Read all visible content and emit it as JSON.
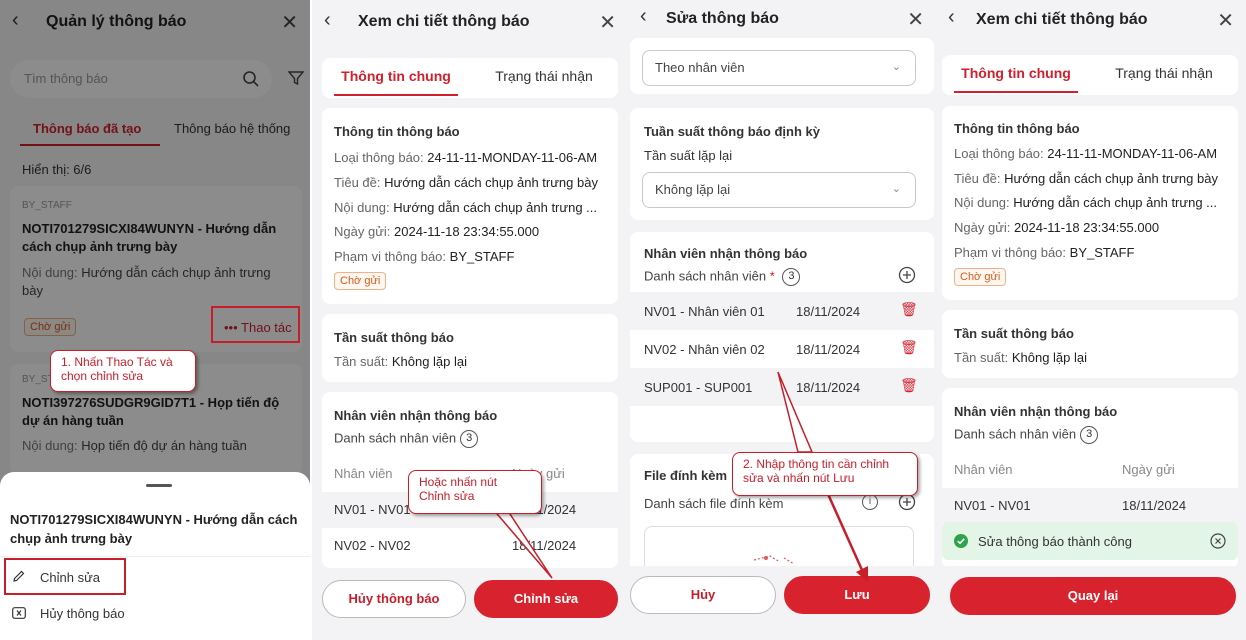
{
  "panel1": {
    "title": "Quản lý thông báo",
    "search_placeholder": "Tìm thông báo",
    "tabs": [
      "Thông báo đã tạo",
      "Thông báo hệ thống"
    ],
    "showing": "Hiển thị: 6/6",
    "card1": {
      "scope": "BY_STAFF",
      "title": "NOTI701279SICXI84WUNYN - Hướng dẫn cách chụp ảnh trưng bày",
      "content_label": "Nội dung:",
      "content": "Hướng dẫn cách chụp ảnh trưng bày",
      "status": "Chờ gửi",
      "action": "Thao tác"
    },
    "card2": {
      "scope": "BY_STAFF",
      "title": "NOTI397276SUDGR9GID7T1 - Họp tiến độ dự án hàng tuần",
      "content_label": "Nội dung:",
      "content": "Họp tiến độ dự án hàng tuần"
    },
    "sheet": {
      "title": "NOTI701279SICXI84WUNYN - Hướng dẫn cách chụp ảnh trưng bày",
      "edit": "Chỉnh sửa",
      "cancel": "Hủy thông báo"
    },
    "callout": "1. Nhấn Thao Tác và chọn chỉnh sửa"
  },
  "panel2": {
    "title": "Xem chi tiết thông báo",
    "tabs": [
      "Thông tin chung",
      "Trạng thái nhận"
    ],
    "info": {
      "heading": "Thông tin thông báo",
      "type_label": "Loại thông báo:",
      "type": "24-11-11-MONDAY-11-06-AM",
      "subject_label": "Tiêu đề:",
      "subject": "Hướng dẫn cách chụp ảnh trưng bày",
      "content_label": "Nội dung:",
      "content": "Hướng dẫn cách chụp ảnh trưng ...",
      "date_label": "Ngày gửi:",
      "date": "2024-11-18 23:34:55.000",
      "scope_label": "Phạm vi thông báo:",
      "scope": "BY_STAFF",
      "status": "Chờ gửi"
    },
    "freq": {
      "heading": "Tần suất thông báo",
      "label": "Tần suất:",
      "value": "Không lặp lại"
    },
    "staff": {
      "heading": "Nhân viên nhận thông báo",
      "list_label": "Danh sách nhân viên",
      "count": "3",
      "col_staff": "Nhân viên",
      "col_date": "Ngày gửi",
      "rows": [
        {
          "name": "NV01 - NV01",
          "date": "18/11/2024"
        },
        {
          "name": "NV02 - NV02",
          "date": "18/11/2024"
        }
      ]
    },
    "btn_cancel": "Hủy thông báo",
    "btn_edit": "Chỉnh sửa",
    "callout": "Hoặc nhấn nút Chỉnh sửa"
  },
  "panel3": {
    "title": "Sửa thông báo",
    "scope_select": "Theo nhân viên",
    "freq_heading": "Tuần suất thông báo định kỳ",
    "repeat_label": "Tần suất lặp lại",
    "repeat_select": "Không lặp lại",
    "staff_heading": "Nhân viên nhận thông báo",
    "staff_list_label": "Danh sách nhân viên",
    "required_mark": "*",
    "staff_count": "3",
    "rows": [
      {
        "name": "NV01 - Nhân viên 01",
        "date": "18/11/2024"
      },
      {
        "name": "NV02 - Nhân viên 02",
        "date": "18/11/2024"
      },
      {
        "name": "SUP001 - SUP001",
        "date": "18/11/2024"
      }
    ],
    "file_heading": "File đính kèm",
    "file_list_label": "Danh sách file đính kèm",
    "btn_cancel": "Hủy",
    "btn_save": "Lưu",
    "callout": "2. Nhập thông tin cần chỉnh sửa và nhấn nút Lưu"
  },
  "panel4": {
    "title": "Xem chi tiết thông báo",
    "tabs": [
      "Thông tin chung",
      "Trạng thái nhận"
    ],
    "info": {
      "heading": "Thông tin thông báo",
      "type_label": "Loại thông báo:",
      "type": "24-11-11-MONDAY-11-06-AM",
      "subject_label": "Tiêu đề:",
      "subject": "Hướng dẫn cách chụp ảnh trưng bày",
      "content_label": "Nội dung:",
      "content": "Hướng dẫn cách chụp ảnh trưng ...",
      "date_label": "Ngày gửi:",
      "date": "2024-11-18 23:34:55.000",
      "scope_label": "Phạm vi thông báo:",
      "scope": "BY_STAFF",
      "status": "Chờ gửi"
    },
    "freq": {
      "heading": "Tần suất thông báo",
      "label": "Tần suất:",
      "value": "Không lặp lại"
    },
    "staff": {
      "heading": "Nhân viên nhận thông báo",
      "list_label": "Danh sách nhân viên",
      "count": "3",
      "col_staff": "Nhân viên",
      "col_date": "Ngày gửi",
      "rows": [
        {
          "name": "NV01 - NV01",
          "date": "18/11/2024"
        }
      ]
    },
    "toast": "Sửa thông báo thành công",
    "btn_back": "Quay lại"
  }
}
